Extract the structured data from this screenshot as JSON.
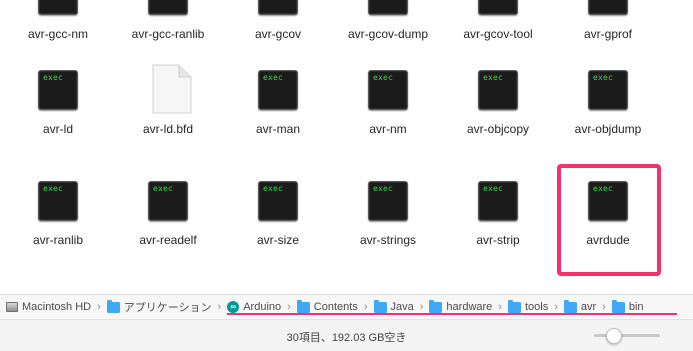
{
  "exec_icon_text": "exec",
  "files_row0": [
    "avr-gcc-nm",
    "avr-gcc-ranlib",
    "avr-gcov",
    "avr-gcov-dump",
    "avr-gcov-tool",
    "avr-gprof"
  ],
  "files_row1": [
    "avr-ld",
    "avr-ld.bfd",
    "avr-man",
    "avr-nm",
    "avr-objcopy",
    "avr-objdump"
  ],
  "files_row2": [
    "avr-ranlib",
    "avr-readelf",
    "avr-size",
    "avr-strings",
    "avr-strip",
    "avrdude"
  ],
  "file_kinds": {
    "avr-ld.bfd": "document-icon",
    "default": "exec-terminal-icon"
  },
  "selected_file": "avrdude",
  "pathbar": {
    "items": [
      {
        "label": "Macintosh HD",
        "icon": "disk-icon"
      },
      {
        "label": "アプリケーション",
        "icon": "folder-icon"
      },
      {
        "label": "Arduino",
        "icon": "arduino-app-icon"
      },
      {
        "label": "Contents",
        "icon": "folder-icon"
      },
      {
        "label": "Java",
        "icon": "folder-icon"
      },
      {
        "label": "hardware",
        "icon": "folder-icon"
      },
      {
        "label": "tools",
        "icon": "folder-icon"
      },
      {
        "label": "avr",
        "icon": "folder-icon"
      },
      {
        "label": "bin",
        "icon": "folder-icon"
      }
    ],
    "separator": "›"
  },
  "status": {
    "text": "30項目、192.03 GB空き",
    "zoom_level": 0.3
  },
  "colors": {
    "highlight": "#f0326d",
    "exec_text": "#39d24a",
    "folder": "#3ea9f5"
  }
}
